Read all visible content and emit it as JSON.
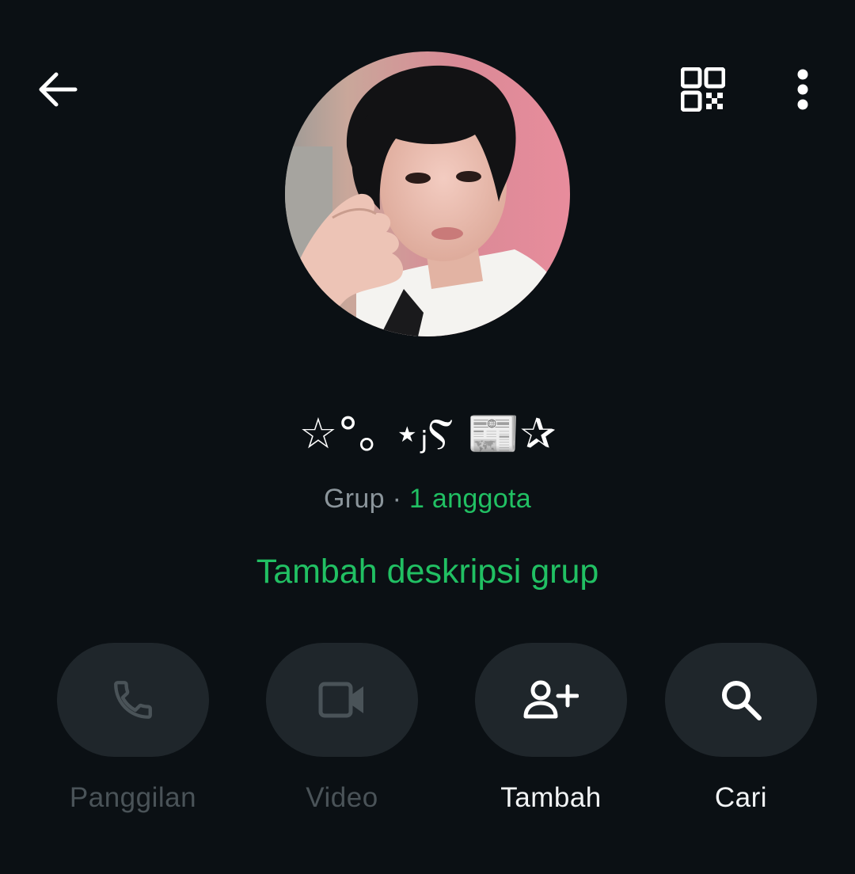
{
  "topbar": {
    "back_icon": "arrow-left-icon",
    "qr_icon": "qr-code-icon",
    "menu_icon": "more-vertical-icon"
  },
  "group": {
    "name": "☆°｡ ⋆ⱼⲊ 📰✰",
    "type_label": "Grup",
    "separator": " · ",
    "members_label": "1 anggota",
    "add_description": "Tambah deskripsi grup"
  },
  "actions": [
    {
      "label": "Panggilan",
      "icon": "phone-icon",
      "enabled": false
    },
    {
      "label": "Video",
      "icon": "video-camera-icon",
      "enabled": false
    },
    {
      "label": "Tambah",
      "icon": "add-person-icon",
      "enabled": true
    },
    {
      "label": "Cari",
      "icon": "search-icon",
      "enabled": true
    }
  ],
  "colors": {
    "background": "#0b1014",
    "accent_green": "#21c063",
    "button_bg": "#1f262b",
    "disabled_text": "#4a5358",
    "secondary_text": "#8b959b"
  }
}
